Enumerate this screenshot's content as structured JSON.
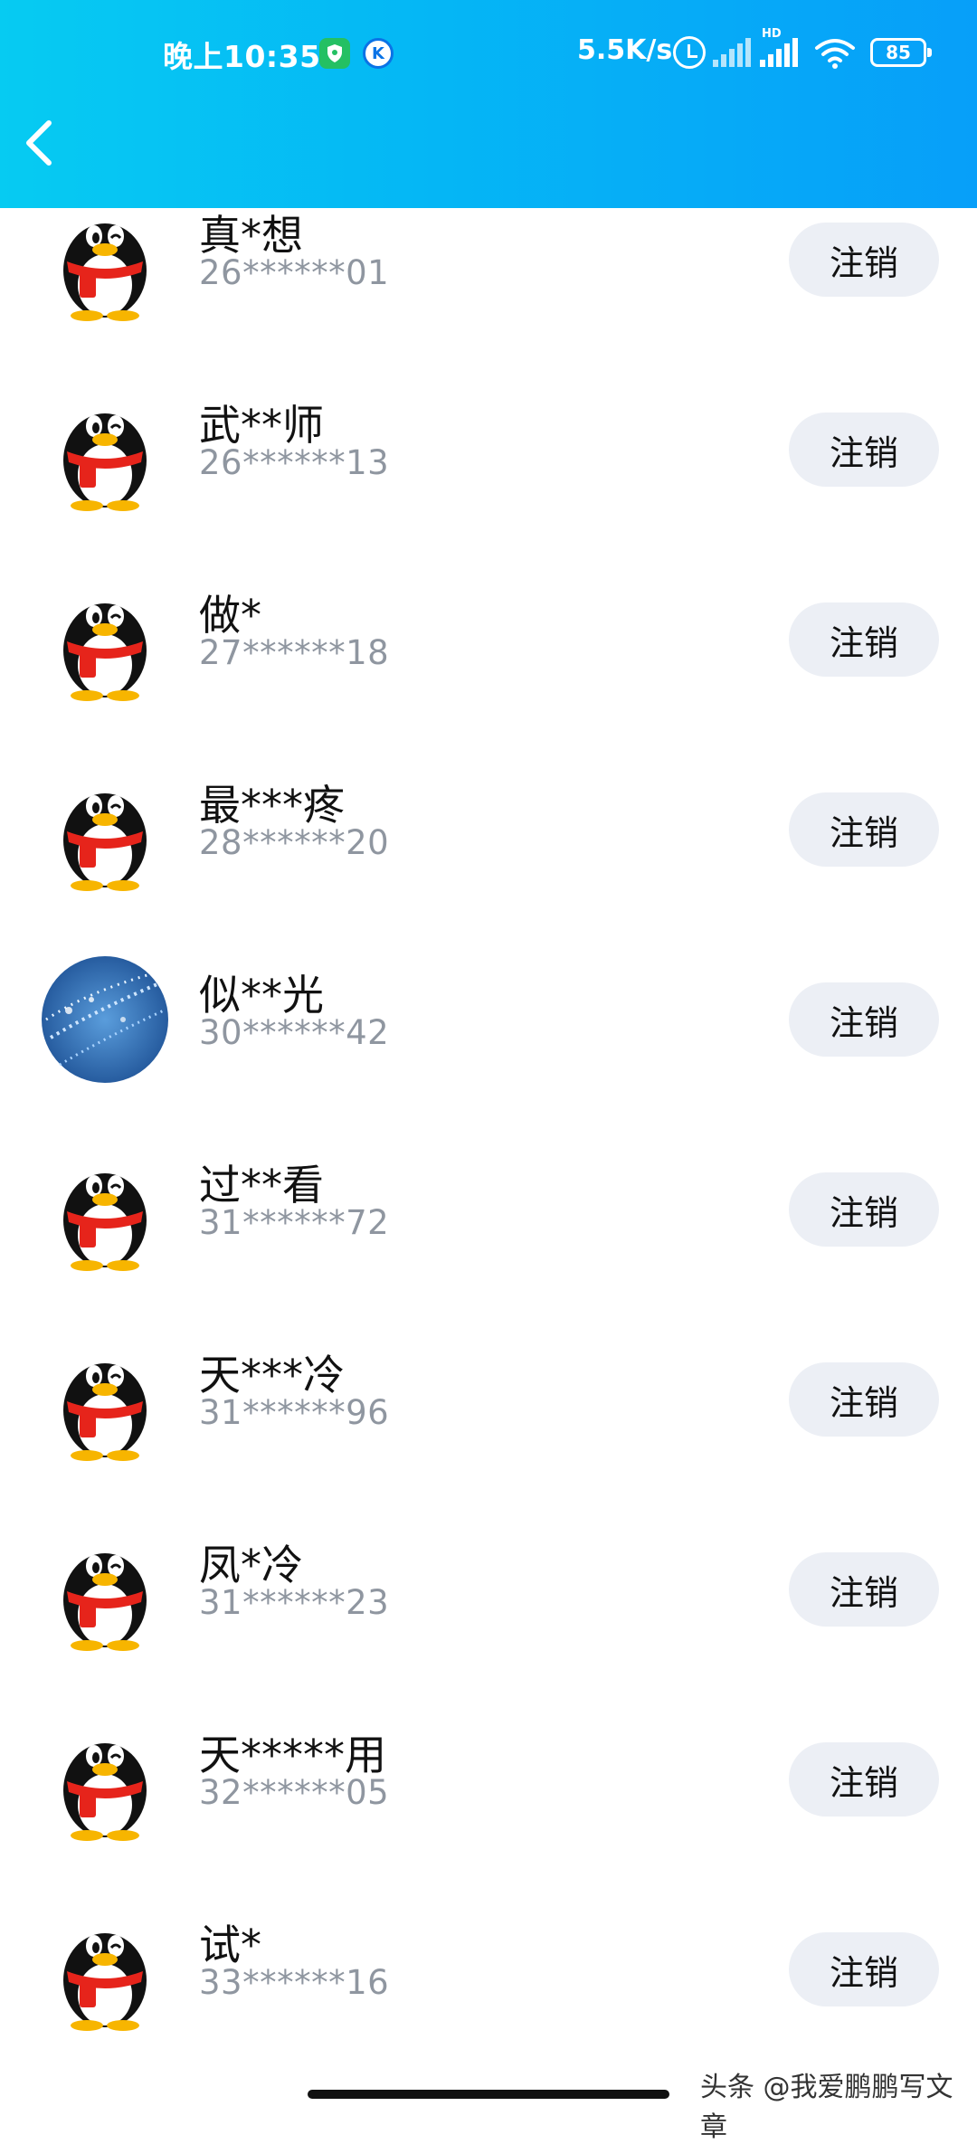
{
  "status_bar": {
    "time": "晚上10:35",
    "net_speed": "5.5K/s",
    "battery": "85",
    "signal_label": "HD",
    "k_badge": "K",
    "icons": [
      "shield-icon",
      "k-icon",
      "alarm-icon",
      "signal-icon",
      "signal-hd-icon",
      "wifi-icon",
      "battery-icon"
    ]
  },
  "header": {
    "back_icon": "chevron-left-icon"
  },
  "accounts": [
    {
      "name": "真*想",
      "qq": "26******01",
      "avatar": "penguin",
      "action": "注销"
    },
    {
      "name": "武**师",
      "qq": "26******13",
      "avatar": "penguin",
      "action": "注销"
    },
    {
      "name": "做*",
      "qq": "27******18",
      "avatar": "penguin",
      "action": "注销"
    },
    {
      "name": "最***疼",
      "qq": "28******20",
      "avatar": "penguin",
      "action": "注销"
    },
    {
      "name": "似**光",
      "qq": "30******42",
      "avatar": "photo",
      "action": "注销"
    },
    {
      "name": "过**看",
      "qq": "31******72",
      "avatar": "penguin",
      "action": "注销"
    },
    {
      "name": "天***冷",
      "qq": "31******96",
      "avatar": "penguin",
      "action": "注销"
    },
    {
      "name": "凤*冷",
      "qq": "31******23",
      "avatar": "penguin",
      "action": "注销"
    },
    {
      "name": "天*****用",
      "qq": "32******05",
      "avatar": "penguin",
      "action": "注销"
    },
    {
      "name": "试*",
      "qq": "33******16",
      "avatar": "penguin",
      "action": "注销"
    }
  ],
  "watermark": "头条 @我爱鹏鹏写文章",
  "colors": {
    "header_start": "#06cbf2",
    "header_end": "#079ff9",
    "button_bg": "#eceff5"
  }
}
